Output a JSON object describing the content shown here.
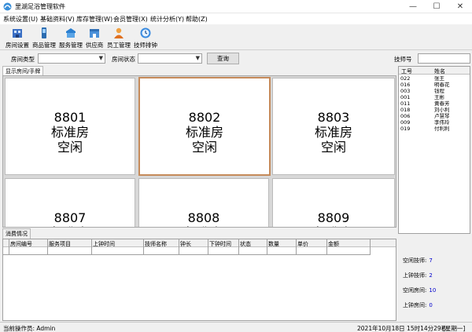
{
  "window": {
    "title": "里湖足浴管理软件",
    "min_glyph": "—",
    "max_glyph": "☐",
    "close_glyph": "✕"
  },
  "menu": [
    {
      "label": "系统设置(U)"
    },
    {
      "label": "基础资料(V)"
    },
    {
      "label": "库存管理(W)"
    },
    {
      "label": "会员管理(X)"
    },
    {
      "label": "统计分析(Y)"
    },
    {
      "label": "帮助(Z)"
    }
  ],
  "toolbar": [
    {
      "label": "房间设置",
      "icon": "room-settings-icon"
    },
    {
      "label": "商品管理",
      "icon": "products-icon"
    },
    {
      "label": "服务管理",
      "icon": "services-icon"
    },
    {
      "label": "供应商",
      "icon": "supplier-icon"
    },
    {
      "label": "员工管理",
      "icon": "staff-icon"
    },
    {
      "label": "技师排钟",
      "icon": "clock-icon"
    }
  ],
  "filter": {
    "room_type_label": "房间类型",
    "room_status_label": "房间状态",
    "query_button": "查询",
    "tech_no_label": "技师号",
    "dropdown_glyph": "▼"
  },
  "room_tab": "显示房间/手牌",
  "rooms": [
    {
      "number": "8801",
      "type": "标准房",
      "status": "空闲"
    },
    {
      "number": "8802",
      "type": "标准房",
      "status": "空闲"
    },
    {
      "number": "8803",
      "type": "标准房",
      "status": "空闲"
    },
    {
      "number": "8807",
      "type": "标准房",
      "status": ""
    },
    {
      "number": "8808",
      "type": "标准房",
      "status": ""
    },
    {
      "number": "8809",
      "type": "标准房",
      "status": ""
    }
  ],
  "technicians": {
    "headers": [
      "工号",
      "姓名"
    ],
    "rows": [
      {
        "id": "022",
        "name": "张王"
      },
      {
        "id": "016",
        "name": "明春花"
      },
      {
        "id": "003",
        "name": "钱程"
      },
      {
        "id": "001",
        "name": "王彬"
      },
      {
        "id": "011",
        "name": "黄春芳"
      },
      {
        "id": "018",
        "name": "刘小利"
      },
      {
        "id": "006",
        "name": "卢慧琴"
      },
      {
        "id": "009",
        "name": "李伟玲"
      },
      {
        "id": "019",
        "name": "付利利"
      }
    ]
  },
  "consumption": {
    "tab": "消费情况",
    "columns": [
      "房间编号",
      "服务项目",
      "上钟时间",
      "技师名称",
      "钟长",
      "下钟时间",
      "状态",
      "数量",
      "单价",
      "金额"
    ]
  },
  "stats": [
    {
      "label": "空闲技师:",
      "value": "7"
    },
    {
      "label": "上钟技师:",
      "value": "2"
    },
    {
      "label": "空闲房间:",
      "value": "10"
    },
    {
      "label": "上钟房间:",
      "value": "0"
    }
  ],
  "status": {
    "operator": "当前操作员: Admin",
    "datetime": "2021年10月18日 15时14分29秒",
    "weekday": "[星期一]"
  }
}
